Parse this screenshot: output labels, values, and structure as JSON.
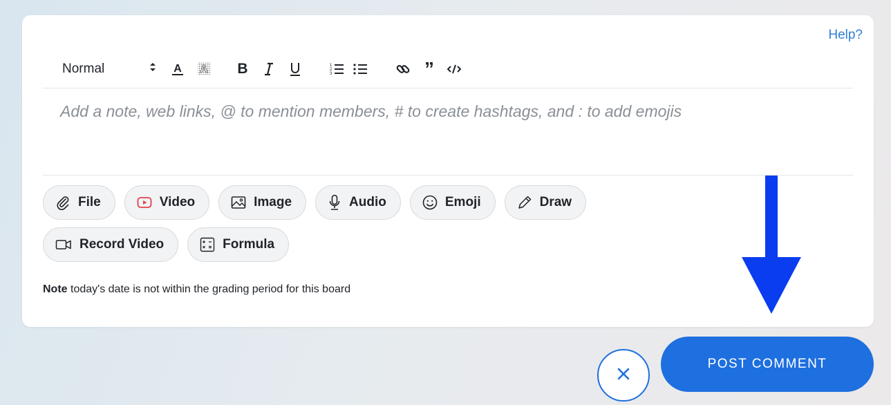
{
  "editor": {
    "help_label": "Help?",
    "format_select": {
      "selected": "Normal"
    },
    "toolbar_icons": [
      "text-color-icon",
      "highlight-color-icon",
      "bold-icon",
      "italic-icon",
      "underline-icon",
      "ordered-list-icon",
      "bullet-list-icon",
      "link-icon",
      "quote-icon",
      "code-icon"
    ],
    "placeholder": "Add a note, web links, @ to mention members, # to create hashtags, and : to add emojis"
  },
  "attachments": {
    "row1": [
      {
        "label": "File",
        "icon": "paperclip-icon"
      },
      {
        "label": "Video",
        "icon": "youtube-play-icon"
      },
      {
        "label": "Image",
        "icon": "image-icon"
      },
      {
        "label": "Audio",
        "icon": "microphone-icon"
      },
      {
        "label": "Emoji",
        "icon": "smiley-icon"
      },
      {
        "label": "Draw",
        "icon": "pencil-icon"
      }
    ],
    "row2": [
      {
        "label": "Record Video",
        "icon": "video-camera-icon"
      },
      {
        "label": "Formula",
        "icon": "calculator-icon"
      }
    ]
  },
  "note": {
    "bold": "Note",
    "text": " today's date is not within the grading period for this board"
  },
  "actions": {
    "post_label": "POST COMMENT",
    "cancel_icon": "close-icon"
  },
  "colors": {
    "accent": "#1e6fdf",
    "annotation_arrow": "#0a3df0",
    "help_link": "#2f7fd7",
    "video_icon": "#e0424b"
  }
}
